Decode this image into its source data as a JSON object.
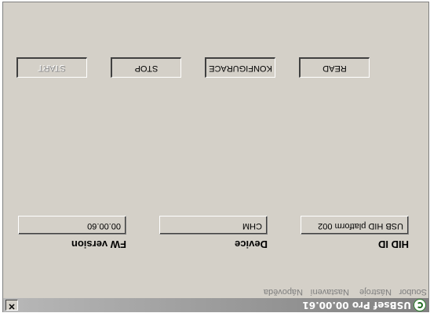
{
  "window": {
    "title": "USBsef Pro 00.00.61",
    "close_label": "✕",
    "app_icon": "app-icon"
  },
  "menu": {
    "items": [
      "Soubor",
      "Nástroje",
      "Nastavení",
      "Nápověda"
    ]
  },
  "fields": {
    "hid": {
      "label": "HID ID",
      "value": "USB HID platform 002"
    },
    "device": {
      "label": "Device",
      "value": "CHM"
    },
    "fw": {
      "label": "FW version",
      "value": "00.00.60"
    }
  },
  "buttons": {
    "start": "START",
    "stop": "STOP",
    "config": "KONFIGURACE",
    "read": "READ"
  }
}
